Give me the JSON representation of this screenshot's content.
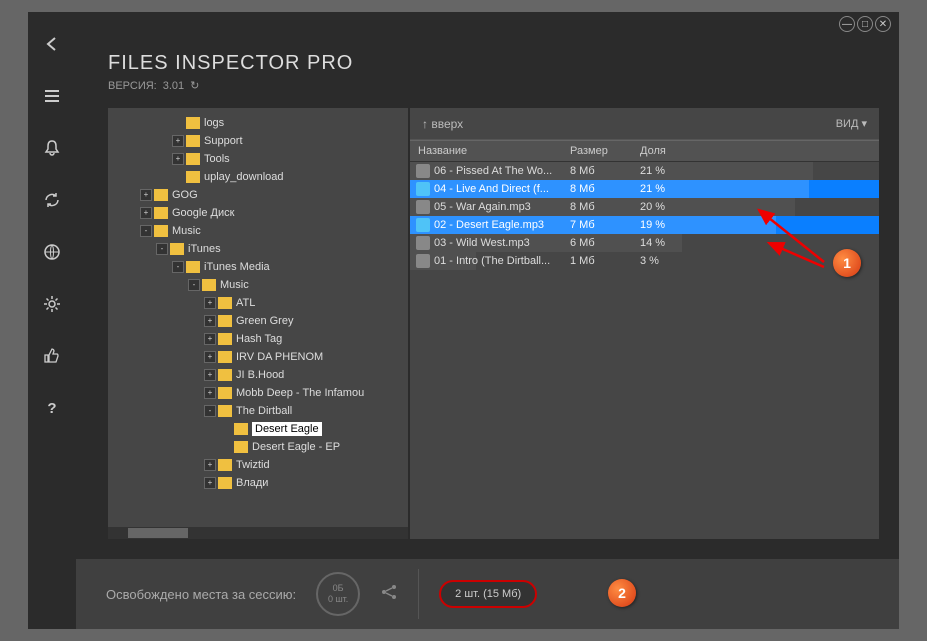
{
  "window": {
    "minimize": "—",
    "maximize": "□",
    "close": "✕"
  },
  "header": {
    "title": "FILES INSPECTOR PRO",
    "version_label": "ВЕРСИЯ:",
    "version_value": "3.01"
  },
  "tree": {
    "indent_unit": 16,
    "items": [
      {
        "depth": 4,
        "expand": null,
        "label": "logs"
      },
      {
        "depth": 4,
        "expand": "+",
        "label": "Support"
      },
      {
        "depth": 4,
        "expand": "+",
        "label": "Tools"
      },
      {
        "depth": 4,
        "expand": null,
        "label": "uplay_download"
      },
      {
        "depth": 2,
        "expand": "+",
        "label": "GOG"
      },
      {
        "depth": 2,
        "expand": "+",
        "label": "Google Диск"
      },
      {
        "depth": 2,
        "expand": "-",
        "label": "Music"
      },
      {
        "depth": 3,
        "expand": "-",
        "label": "iTunes"
      },
      {
        "depth": 4,
        "expand": "-",
        "label": "iTunes Media"
      },
      {
        "depth": 5,
        "expand": "-",
        "label": "Music"
      },
      {
        "depth": 6,
        "expand": "+",
        "label": "ATL"
      },
      {
        "depth": 6,
        "expand": "+",
        "label": "Green Grey"
      },
      {
        "depth": 6,
        "expand": "+",
        "label": "Hash Tag"
      },
      {
        "depth": 6,
        "expand": "+",
        "label": "IRV DA PHENOM"
      },
      {
        "depth": 6,
        "expand": "+",
        "label": "JI B.Hood"
      },
      {
        "depth": 6,
        "expand": "+",
        "label": "Mobb Deep - The Infamou"
      },
      {
        "depth": 6,
        "expand": "-",
        "label": "The Dirtball"
      },
      {
        "depth": 7,
        "expand": null,
        "label": "Desert Eagle",
        "selected": true
      },
      {
        "depth": 7,
        "expand": null,
        "label": "Desert Eagle - EP"
      },
      {
        "depth": 6,
        "expand": "+",
        "label": "Twiztid"
      },
      {
        "depth": 6,
        "expand": "+",
        "label": "Влади"
      }
    ]
  },
  "list": {
    "up_label": "↑ вверх",
    "view_label": "ВИД ▾",
    "columns": {
      "name": "Название",
      "size": "Размер",
      "share": "Доля"
    },
    "rows": [
      {
        "name": "06 - Pissed At The Wo...",
        "size": "8 Мб",
        "share": "21 %",
        "bar": 86,
        "selected": false
      },
      {
        "name": "04 - Live And Direct (f...",
        "size": "8 Мб",
        "share": "21 %",
        "bar": 85,
        "selected": true
      },
      {
        "name": "05 - War Again.mp3",
        "size": "8 Мб",
        "share": "20 %",
        "bar": 82,
        "selected": false
      },
      {
        "name": "02 - Desert Eagle.mp3",
        "size": "7 Мб",
        "share": "19 %",
        "bar": 78,
        "selected": true
      },
      {
        "name": "03 - Wild West.mp3",
        "size": "6 Мб",
        "share": "14 %",
        "bar": 58,
        "selected": false
      },
      {
        "name": "01 - Intro (The Dirtball...",
        "size": "1 Мб",
        "share": "3 %",
        "bar": 14,
        "selected": false
      }
    ]
  },
  "footer": {
    "session_text": "Освобождено места за сессию:",
    "circle_top": "0Б",
    "circle_bottom": "0 шт.",
    "selection_badge": "2 шт. (15 Мб)"
  },
  "annotations": {
    "badge1": "1",
    "badge2": "2"
  }
}
